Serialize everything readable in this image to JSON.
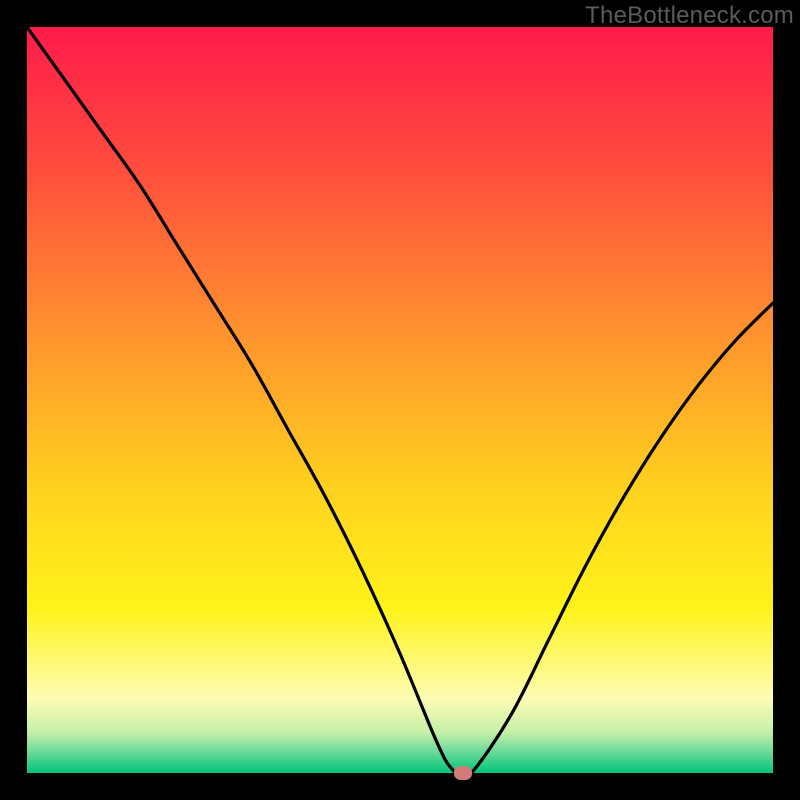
{
  "watermark": "TheBottleneck.com",
  "chart_data": {
    "type": "line",
    "title": "",
    "xlabel": "",
    "ylabel": "",
    "xlim": [
      0,
      100
    ],
    "ylim": [
      0,
      100
    ],
    "grid": false,
    "legend": false,
    "gradient_stops": [
      {
        "offset": 0,
        "color": "#ff1b4b"
      },
      {
        "offset": 0.18,
        "color": "#ff4a3d"
      },
      {
        "offset": 0.4,
        "color": "#ff8f2f"
      },
      {
        "offset": 0.62,
        "color": "#ffd21e"
      },
      {
        "offset": 0.78,
        "color": "#fff31a"
      },
      {
        "offset": 0.9,
        "color": "#fdfcb3"
      },
      {
        "offset": 0.945,
        "color": "#c7f0a8"
      },
      {
        "offset": 0.97,
        "color": "#71db9a"
      },
      {
        "offset": 1.0,
        "color": "#00c47a"
      }
    ],
    "series": [
      {
        "name": "bottleneck-curve",
        "x": [
          0,
          5,
          10,
          15,
          20,
          25,
          30,
          35,
          40,
          45,
          50,
          55,
          57,
          58.5,
          60,
          65,
          70,
          75,
          80,
          85,
          90,
          95,
          100
        ],
        "y": [
          100,
          93,
          86,
          79,
          71,
          63,
          55,
          46,
          37,
          27,
          16,
          4,
          0.5,
          0,
          0.5,
          8,
          18,
          28,
          37,
          45,
          52,
          58,
          63
        ]
      }
    ],
    "marker": {
      "x": 58.5,
      "y": 0,
      "color": "#d37b79"
    }
  }
}
